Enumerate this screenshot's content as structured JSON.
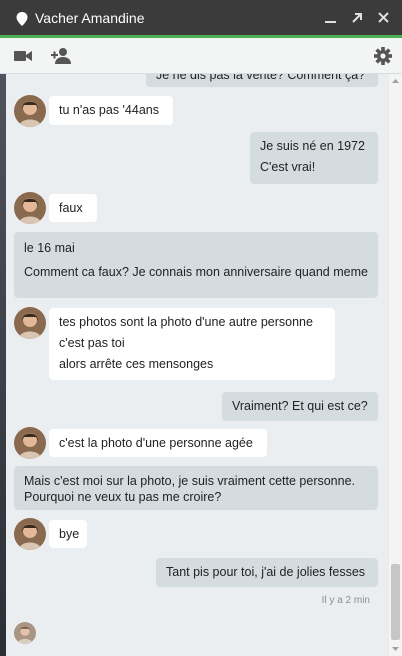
{
  "window": {
    "title": "Vacher Amandine",
    "buttons": [
      "minimize-icon",
      "popout-icon",
      "close-icon"
    ],
    "accent": "#4caf50"
  },
  "toolbar": {
    "icons": [
      "video-call-icon",
      "add-person-icon",
      "settings-gear-icon"
    ]
  },
  "messages": [
    {
      "from": "me",
      "lines": [
        "Je ne dis pas la vérité? Comment ça?"
      ]
    },
    {
      "from": "them",
      "lines": [
        "tu n'as pas '44ans"
      ]
    },
    {
      "from": "me",
      "lines": [
        "Je suis né en 1972",
        "C'est vrai!"
      ]
    },
    {
      "from": "them",
      "lines": [
        "faux"
      ]
    },
    {
      "from": "me",
      "lines": [
        "le 16 mai",
        "Comment ca faux? Je connais mon anniversaire quand meme"
      ]
    },
    {
      "from": "them",
      "lines": [
        "tes photos sont la photo d'une autre personne",
        "c'est pas toi",
        "alors arrête ces mensonges"
      ]
    },
    {
      "from": "me",
      "lines": [
        "Vraiment? Et qui est ce?"
      ]
    },
    {
      "from": "them",
      "lines": [
        "c'est la photo d'une personne agée"
      ]
    },
    {
      "from": "me",
      "lines": [
        "Mais c'est moi sur la photo, je suis vraiment cette personne. Pourquoi ne veux tu pas me croire?"
      ]
    },
    {
      "from": "them",
      "lines": [
        "bye"
      ]
    },
    {
      "from": "me",
      "lines": [
        "Tant pis pour toi, j'ai de jolies fesses"
      ]
    }
  ],
  "status": {
    "timestamp": "Il y a 2 min"
  }
}
